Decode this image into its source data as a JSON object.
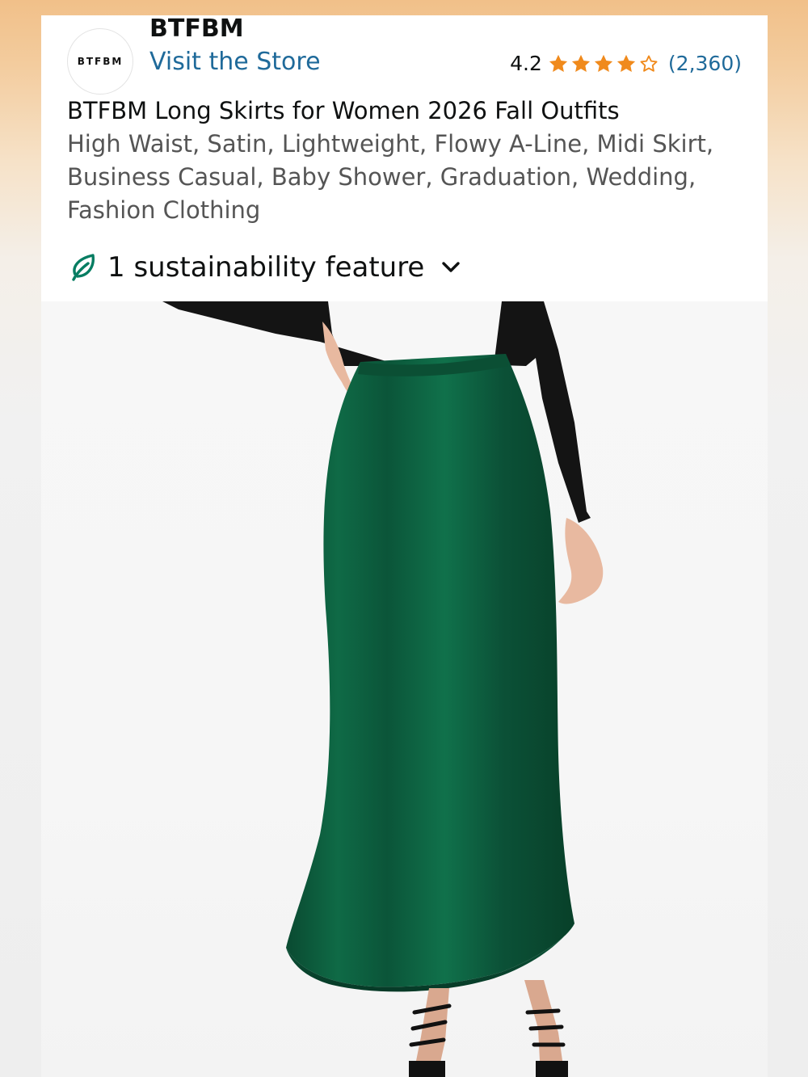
{
  "store": {
    "logo_text": "BTFBM",
    "brand_name": "BTFBM",
    "visit_link": "Visit the Store"
  },
  "rating": {
    "value": "4.2",
    "stars": 4.2,
    "count": "(2,360)",
    "star_color": "#f08a1c"
  },
  "product": {
    "title_main": "BTFBM Long Skirts for Women 2026 Fall Outfits",
    "title_rest": "High Waist, Satin, Lightweight, Flowy A-Line, Midi Skirt, Business Casual, Baby Shower, Graduation, Wedding, Fashion Clothing"
  },
  "sustainability": {
    "label": "1 sustainability feature",
    "icon": "leaf-icon",
    "icon_color": "#067d62"
  },
  "image": {
    "subject": "product-photo",
    "skirt_color": "#0d5a3c"
  },
  "colors": {
    "link": "#1f6a9a",
    "text": "#0f1111",
    "muted": "#555555"
  }
}
